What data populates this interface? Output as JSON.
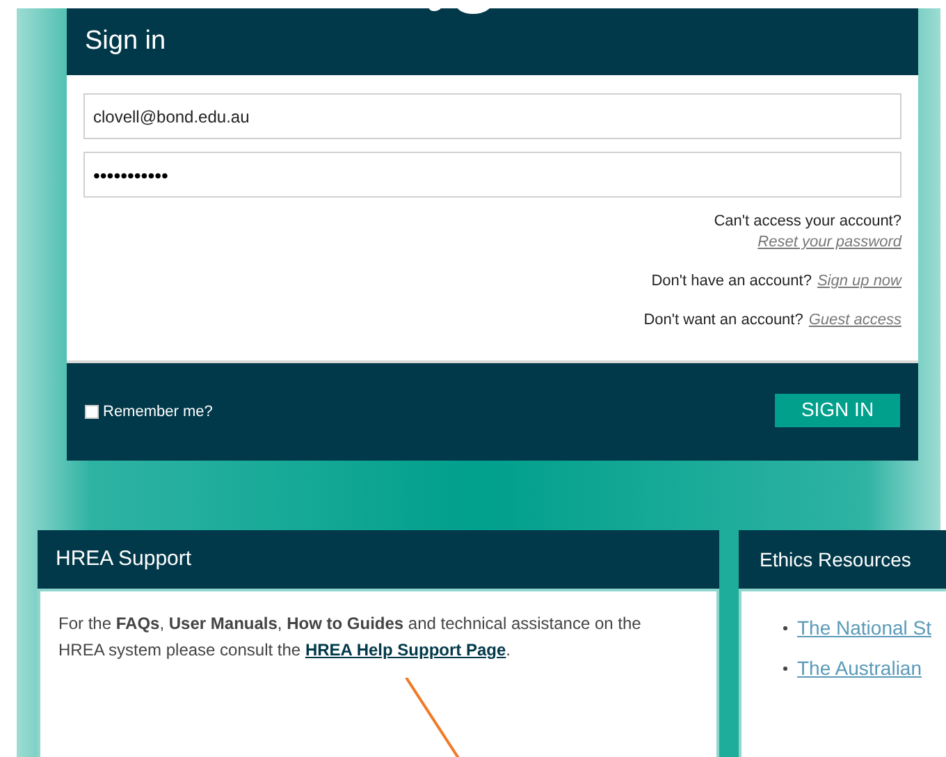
{
  "signin": {
    "title": "Sign in",
    "email": "clovell@bond.edu.au",
    "password": "•••••••••••",
    "help_links": [
      {
        "prompt": "Can't access your account?",
        "link": "Reset your password",
        "stacked": true
      },
      {
        "prompt": "Don't have an account?",
        "link": "Sign up now",
        "stacked": false
      },
      {
        "prompt": "Don't want an account?",
        "link": "Guest access",
        "stacked": false
      }
    ],
    "remember": {
      "label": "Remember me?",
      "checked": false
    },
    "button": "SIGN IN"
  },
  "support": {
    "title": "HREA Support",
    "text": "For the **FAQs**, **User Manuals**, **How to Guides** and technical assistance on the HREA system please consult the",
    "link": "HREA Help Support Page",
    "after": "."
  },
  "ethics": {
    "title": "Ethics Resources",
    "links": [
      "The National St",
      "The Australian"
    ]
  }
}
